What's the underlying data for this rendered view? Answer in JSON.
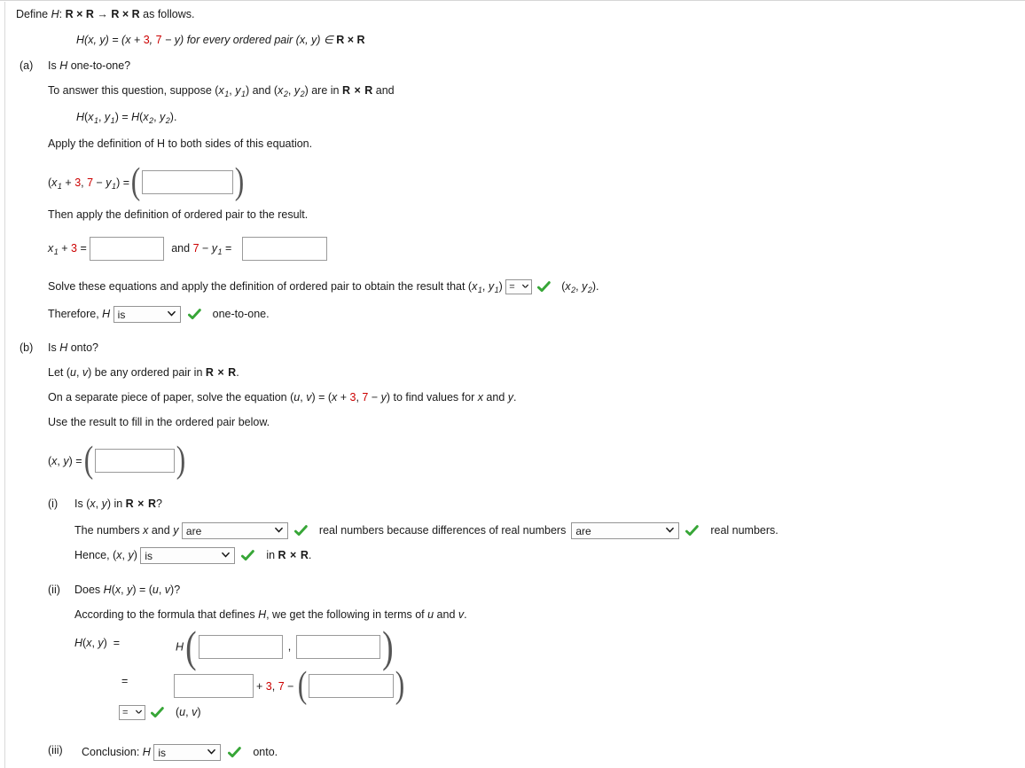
{
  "colors": {
    "accent_red": "#cc0000",
    "check_green": "#37a637",
    "border_grey": "#9a9a9a",
    "text": "#1a1a1a"
  },
  "icons": {
    "check": "green-check-icon",
    "chevron": "chevron-down-icon"
  },
  "intro": {
    "line1_pre": "Define ",
    "line1_H": "H",
    "line1_colon": ": ",
    "line1_RxR": "R × R",
    "line1_arrow": " → ",
    "line1_RxR2": "R × R",
    "line1_post": " as follows.",
    "formula_prefix": "H(x, y) = (x + ",
    "formula_three": "3",
    "formula_mid": ", ",
    "formula_seven": "7",
    "formula_minus_y": " − y) for every ordered pair (x, y) ∈ ",
    "formula_RxR": "R × R"
  },
  "part_a": {
    "marker": "(a)",
    "question": "Is H one-to-one?",
    "suppose_text": "To answer this question, suppose (x1, y1) and (x2, y2) are in R × R and",
    "equation": "H(x1, y1) = H(x2, y2).",
    "apply_text": "Apply the definition of H to both sides of this equation.",
    "row1_lhs": "(x1 + 3, 7 − y1) =",
    "row1_box_value": "",
    "row1_box_placeholder": "",
    "then_text": "Then apply the definition of ordered pair to the result.",
    "row2_lhs": "x1 + 3 =",
    "row2_box_value": "",
    "row2_mid": "and 7 − y1 =",
    "row2_box2_value": "",
    "solve_text_pre": "Solve these equations and apply the definition of ordered pair to obtain the result that (x1, y1)",
    "solve_select_value": "=",
    "solve_text_post": "(x2, y2).",
    "therefore_pre": "Therefore, H",
    "therefore_select_value": "is",
    "therefore_post": "one-to-one."
  },
  "part_b": {
    "marker": "(b)",
    "question": "Is H onto?",
    "let_text": "Let (u, v) be any ordered pair in R × R.",
    "solve_text_pre": "On a separate piece of paper, solve the equation (u, v) = (x + ",
    "solve_three": "3",
    "solve_mid": ", ",
    "solve_seven": "7",
    "solve_text_post": " − y) to find values for x and y.",
    "use_text": "Use the result to fill in the ordered pair below.",
    "pair_lhs": "(x, y) =",
    "pair_box_value": ""
  },
  "part_bi": {
    "marker": "(i)",
    "question": "Is (x, y) in R × R?",
    "line1_pre": "The numbers x and y",
    "line1_select_value": "are",
    "line1_mid": "real numbers because differences of real numbers",
    "line1_select2_value": "are",
    "line1_post": "real numbers.",
    "line2_pre": "Hence, (x, y)",
    "line2_select_value": "is",
    "line2_post": "in R × R."
  },
  "part_bii": {
    "marker": "(ii)",
    "question": "Does H(x, y) = (u, v)?",
    "according_text": "According to the formula that defines H, we get the following in terms of u and v.",
    "row1_lhs": "H(x, y)  =",
    "row1_H": "H",
    "row1_box1_value": "",
    "row1_comma": ",",
    "row1_box2_value": "",
    "row2_eq": "=",
    "row2_box1_value": "",
    "row2_plus": " + ",
    "row2_three": "3",
    "row2_comma": ", ",
    "row2_seven": "7",
    "row2_minus": " − ",
    "row2_box2_value": "",
    "row3_select_value": "=",
    "row3_text": "(u, v)"
  },
  "part_biii": {
    "marker": "(iii)",
    "label_pre": "Conclusion: H",
    "select_value": "is",
    "label_post": "onto."
  }
}
